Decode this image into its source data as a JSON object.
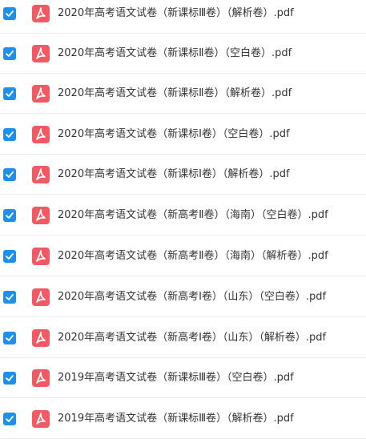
{
  "colors": {
    "checkbox": "#1e8fea",
    "pdf_icon": "#f05a63",
    "text": "#333333",
    "divider": "#ececec"
  },
  "files": [
    {
      "name": "2020年高考语文试卷（新课标Ⅲ卷）（解析卷）.pdf",
      "checked": true,
      "icon": "pdf-icon"
    },
    {
      "name": "2020年高考语文试卷（新课标Ⅱ卷）（空白卷）.pdf",
      "checked": true,
      "icon": "pdf-icon"
    },
    {
      "name": "2020年高考语文试卷（新课标Ⅱ卷）（解析卷）.pdf",
      "checked": true,
      "icon": "pdf-icon"
    },
    {
      "name": "2020年高考语文试卷（新课标Ⅰ卷）（空白卷）.pdf",
      "checked": true,
      "icon": "pdf-icon"
    },
    {
      "name": "2020年高考语文试卷（新课标Ⅰ卷）（解析卷）.pdf",
      "checked": true,
      "icon": "pdf-icon"
    },
    {
      "name": "2020年高考语文试卷（新高考Ⅱ卷）（海南）（空白卷）.pdf",
      "checked": true,
      "icon": "pdf-icon"
    },
    {
      "name": "2020年高考语文试卷（新高考Ⅱ卷）（海南）（解析卷）.pdf",
      "checked": true,
      "icon": "pdf-icon"
    },
    {
      "name": "2020年高考语文试卷（新高考Ⅰ卷）（山东）（空白卷）.pdf",
      "checked": true,
      "icon": "pdf-icon"
    },
    {
      "name": "2020年高考语文试卷（新高考Ⅰ卷）（山东）（解析卷）.pdf",
      "checked": true,
      "icon": "pdf-icon"
    },
    {
      "name": "2019年高考语文试卷（新课标Ⅲ卷）（空白卷）.pdf",
      "checked": true,
      "icon": "pdf-icon"
    },
    {
      "name": "2019年高考语文试卷（新课标Ⅲ卷）（解析卷）.pdf",
      "checked": true,
      "icon": "pdf-icon"
    }
  ]
}
